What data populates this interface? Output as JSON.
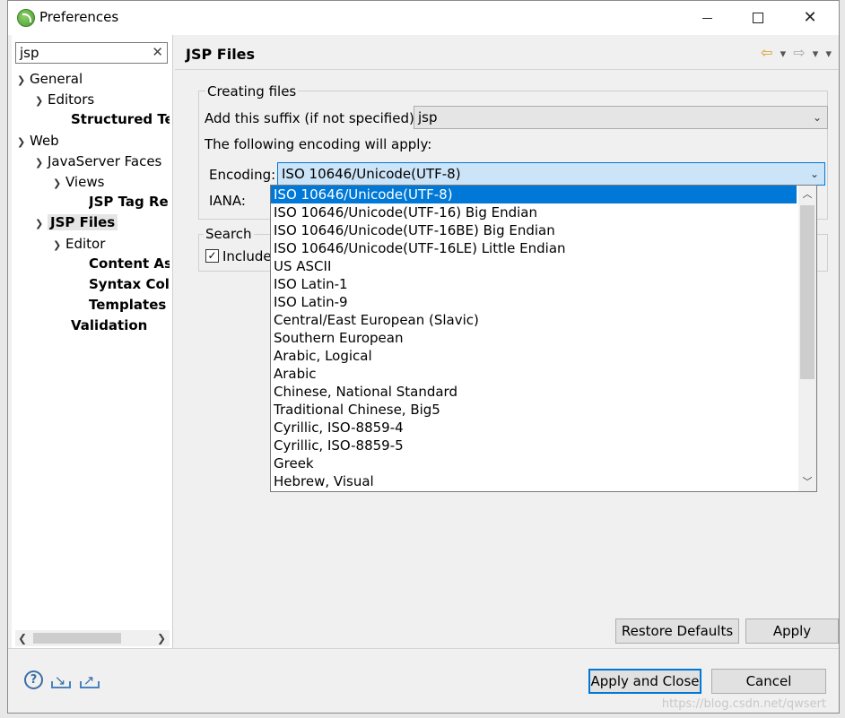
{
  "window": {
    "title": "Preferences"
  },
  "filter": {
    "value": "jsp"
  },
  "tree": [
    {
      "label": "General",
      "expanded": true
    },
    {
      "label": "Editors",
      "expanded": true
    },
    {
      "label": "Structured Te"
    },
    {
      "label": "Web",
      "expanded": true
    },
    {
      "label": "JavaServer Faces",
      "expanded": true
    },
    {
      "label": "Views",
      "expanded": true
    },
    {
      "label": "JSP Tag Re"
    },
    {
      "label": "JSP Files",
      "expanded": true,
      "selected": true
    },
    {
      "label": "Editor",
      "expanded": true
    },
    {
      "label": "Content As"
    },
    {
      "label": "Syntax Col"
    },
    {
      "label": "Templates"
    },
    {
      "label": "Validation"
    }
  ],
  "page": {
    "title": "JSP Files",
    "creating_group": "Creating files",
    "suffix_label": "Add this suffix (if not specified):",
    "suffix_value": "jsp",
    "encoding_note": "The following encoding will apply:",
    "encoding_label": "Encoding:",
    "encoding_value": "ISO 10646/Unicode(UTF-8)",
    "iana_label": "IANA:",
    "search_group": "Search",
    "include_label": "Include J"
  },
  "encoding_options": [
    "ISO 10646/Unicode(UTF-8)",
    "ISO 10646/Unicode(UTF-16) Big Endian",
    "ISO 10646/Unicode(UTF-16BE) Big Endian",
    "ISO 10646/Unicode(UTF-16LE) Little Endian",
    "US ASCII",
    "ISO Latin-1",
    "ISO Latin-9",
    "Central/East European (Slavic)",
    "Southern European",
    "Arabic, Logical",
    "Arabic",
    "Chinese, National Standard",
    "Traditional Chinese, Big5",
    "Cyrillic, ISO-8859-4",
    "Cyrillic, ISO-8859-5",
    "Greek",
    "Hebrew, Visual"
  ],
  "buttons": {
    "restore": "Restore Defaults",
    "apply": "Apply",
    "apply_close": "Apply and Close",
    "cancel": "Cancel"
  },
  "footer": {
    "help_glyph": "?"
  },
  "watermark": "https://blog.csdn.net/qwsert"
}
